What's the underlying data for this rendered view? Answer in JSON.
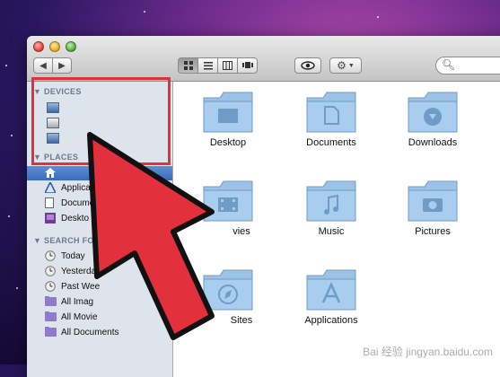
{
  "finder": {
    "sidebar": {
      "devices_heading": "DEVICES",
      "places_heading": "PLACES",
      "search_heading": "SEARCH FO",
      "places": [
        {
          "label": "",
          "icon": "home-icon"
        },
        {
          "label": "Applicati",
          "icon": "applications-icon"
        },
        {
          "label": "Docume",
          "icon": "documents-icon"
        },
        {
          "label": "Deskto",
          "icon": "desktop-icon"
        }
      ],
      "searches": [
        {
          "label": "Today",
          "icon": "clock-icon"
        },
        {
          "label": "Yesterda",
          "icon": "clock-icon"
        },
        {
          "label": "Past Wee",
          "icon": "clock-icon"
        },
        {
          "label": "All Imag",
          "icon": "smart-folder-icon"
        },
        {
          "label": "All Movie",
          "icon": "smart-folder-icon"
        },
        {
          "label": "All Documents",
          "icon": "smart-folder-icon"
        }
      ]
    },
    "folders": [
      {
        "label": "Desktop",
        "icon": "desktop-folder-icon"
      },
      {
        "label": "Documents",
        "icon": "documents-folder-icon"
      },
      {
        "label": "Downloads",
        "icon": "downloads-folder-icon"
      },
      {
        "label": "vies",
        "icon": "movies-folder-icon"
      },
      {
        "label": "Music",
        "icon": "music-folder-icon"
      },
      {
        "label": "Pictures",
        "icon": "pictures-folder-icon"
      },
      {
        "label": "Sites",
        "icon": "sites-folder-icon"
      },
      {
        "label": "Applications",
        "icon": "applications-folder-icon"
      }
    ]
  },
  "overlay": {
    "highlight_color": "#e2303c",
    "arrow_color": "#e2303c",
    "watermark": "Bai 经验 jingyan.baidu.com"
  }
}
